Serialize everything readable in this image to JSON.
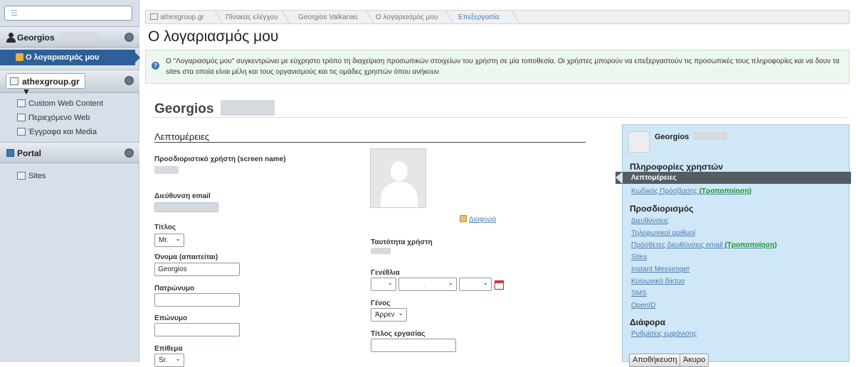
{
  "sidebar": {
    "search_placeholder": "",
    "user": {
      "name": "Georgios"
    },
    "active_item": "Ο λογαριασμός μου",
    "site_selector": "athexgroup.gr ▼",
    "site_items": [
      {
        "label": "Custom Web Content",
        "icon": "content-icon"
      },
      {
        "label": "Περιεχόμενο Web",
        "icon": "web-content-icon"
      },
      {
        "label": "Έγγραφα και Media",
        "icon": "documents-icon"
      }
    ],
    "portal": {
      "title": "Portal",
      "items": [
        {
          "label": "Sites",
          "icon": "sites-icon"
        }
      ]
    }
  },
  "breadcrumb": [
    "athexgroup.gr",
    "Πίνακας ελέγχου",
    "Georgios Valkanas",
    "Ο λογαριασμός μου",
    "Επεξεργασία"
  ],
  "page": {
    "title": "Ο λογαριασμός μου",
    "info": "Ο \"Λογαριασμός μου\" συγκεντρώνει με εύχρηστο τρόπο τη διαχείριση προσωπικών στοιχείων του χρήστη σε μία τοποθεσία. Οι χρήστες μπορούν να επεξεργαστούν τις προσωπικές τους πληροφορίες και να δουν τα sites στα οποία είναι μέλη και τους οργανισμούς και τις ομάδες χρηστών όπου ανήκουν.",
    "user_name": "Georgios"
  },
  "form": {
    "section_title": "Λεπτομέρειες",
    "screen_name_label": "Προσδιοριστικό χρήστη (screen name)",
    "email_label": "Διεύθυνση email",
    "title_label": "Τίτλος",
    "title_value": "Mr.",
    "first_name_label": "Όνομα (απαιτείται)",
    "first_name_value": "Georgios",
    "middle_name_label": "Πατρώνυμο",
    "middle_name_value": "",
    "last_name_label": "Επώνυμο",
    "last_name_value": "",
    "suffix_label": "Επίθεμα",
    "suffix_value": "Sr.",
    "change_link": "Διαφορά",
    "user_id_label": "Ταυτότητα χρήστη",
    "birthday_label": "Γενέθλια",
    "birthday_day": "",
    "birthday_month": ".",
    "birthday_year": "",
    "gender_label": "Γένος",
    "gender_value": "Άρρεν",
    "job_title_label": "Τίτλος εργασίας",
    "job_title_value": ""
  },
  "panel": {
    "user_name": "Georgios",
    "user_info_title": "Πληροφορίες χρηστών",
    "active_item": "Λεπτομέρειες",
    "password_link": "Κωδικός Πρόσβασης",
    "modified": "(Τροποποίηση)",
    "identification_title": "Προσδιορισμός",
    "identification_items": [
      "Διευθύνσεις",
      "Τηλεφωνικοί αριθμοί",
      "Πρόσθετες διευθύνσεις email",
      "Sites",
      "Instant Messenger",
      "Κοινωνικό δίκτυο",
      "SMS",
      "OpenID"
    ],
    "misc_title": "Διάφορα",
    "misc_items": [
      "Ρυθμίσεις εμφάνισης"
    ],
    "save_button": "Αποθήκευση",
    "cancel_button": "Άκυρο"
  },
  "colors": {
    "accent": "#2e5f98",
    "panel_bg": "#cfe7f6",
    "modified": "#1e8f2e",
    "link": "#4f7cb0"
  }
}
